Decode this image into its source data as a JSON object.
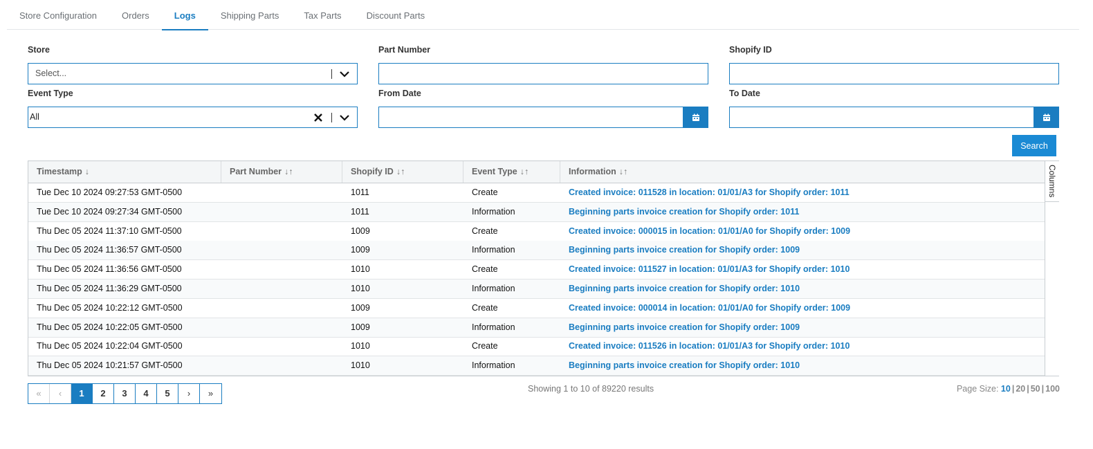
{
  "tabs": [
    {
      "label": "Store Configuration"
    },
    {
      "label": "Orders"
    },
    {
      "label": "Logs"
    },
    {
      "label": "Shipping Parts"
    },
    {
      "label": "Tax Parts"
    },
    {
      "label": "Discount Parts"
    }
  ],
  "active_tab": "Logs",
  "filters": {
    "store": {
      "label": "Store",
      "placeholder": "Select..."
    },
    "part_number": {
      "label": "Part Number",
      "value": ""
    },
    "shopify_id": {
      "label": "Shopify ID",
      "value": ""
    },
    "event_type": {
      "label": "Event Type",
      "value": "All"
    },
    "from_date": {
      "label": "From Date",
      "value": ""
    },
    "to_date": {
      "label": "To Date",
      "value": ""
    }
  },
  "search_button": "Search",
  "table": {
    "columns": [
      {
        "label": "Timestamp",
        "sort": "↓"
      },
      {
        "label": "Part Number",
        "sort": "↓↑"
      },
      {
        "label": "Shopify ID",
        "sort": "↓↑"
      },
      {
        "label": "Event Type",
        "sort": "↓↑"
      },
      {
        "label": "Information",
        "sort": "↓↑"
      }
    ],
    "columns_panel_label": "Columns",
    "rows": [
      {
        "timestamp": "Tue Dec 10 2024 09:27:53 GMT-0500",
        "part_number": "",
        "shopify_id": "1011",
        "event_type": "Create",
        "information": "Created invoice: 011528 in location: 01/01/A3 for Shopify order: 1011"
      },
      {
        "timestamp": "Tue Dec 10 2024 09:27:34 GMT-0500",
        "part_number": "",
        "shopify_id": "1011",
        "event_type": "Information",
        "information": "Beginning parts invoice creation for Shopify order: 1011"
      },
      {
        "timestamp": "Thu Dec 05 2024 11:37:10 GMT-0500",
        "part_number": "",
        "shopify_id": "1009",
        "event_type": "Create",
        "information": "Created invoice: 000015 in location: 01/01/A0 for Shopify order: 1009"
      },
      {
        "timestamp": "Thu Dec 05 2024 11:36:57 GMT-0500",
        "part_number": "",
        "shopify_id": "1009",
        "event_type": "Information",
        "information": "Beginning parts invoice creation for Shopify order: 1009"
      },
      {
        "timestamp": "Thu Dec 05 2024 11:36:56 GMT-0500",
        "part_number": "",
        "shopify_id": "1010",
        "event_type": "Create",
        "information": "Created invoice: 011527 in location: 01/01/A3 for Shopify order: 1010"
      },
      {
        "timestamp": "Thu Dec 05 2024 11:36:29 GMT-0500",
        "part_number": "",
        "shopify_id": "1010",
        "event_type": "Information",
        "information": "Beginning parts invoice creation for Shopify order: 1010"
      },
      {
        "timestamp": "Thu Dec 05 2024 10:22:12 GMT-0500",
        "part_number": "",
        "shopify_id": "1009",
        "event_type": "Create",
        "information": "Created invoice: 000014 in location: 01/01/A0 for Shopify order: 1009"
      },
      {
        "timestamp": "Thu Dec 05 2024 10:22:05 GMT-0500",
        "part_number": "",
        "shopify_id": "1009",
        "event_type": "Information",
        "information": "Beginning parts invoice creation for Shopify order: 1009"
      },
      {
        "timestamp": "Thu Dec 05 2024 10:22:04 GMT-0500",
        "part_number": "",
        "shopify_id": "1010",
        "event_type": "Create",
        "information": "Created invoice: 011526 in location: 01/01/A3 for Shopify order: 1010"
      },
      {
        "timestamp": "Thu Dec 05 2024 10:21:57 GMT-0500",
        "part_number": "",
        "shopify_id": "1010",
        "event_type": "Information",
        "information": "Beginning parts invoice creation for Shopify order: 1010"
      }
    ]
  },
  "pagination": {
    "first": "«",
    "prev": "‹",
    "pages": [
      "1",
      "2",
      "3",
      "4",
      "5"
    ],
    "current": "1",
    "next": "›",
    "last": "»",
    "showing_text": "Showing 1 to 10 of 89220 results",
    "page_size_label": "Page Size:",
    "page_sizes": [
      "10",
      "20",
      "50",
      "100"
    ],
    "active_page_size": "10"
  },
  "colors": {
    "accent": "#1a7dc1",
    "button": "#1a8ad4",
    "link_text": "#1a7dc1"
  }
}
